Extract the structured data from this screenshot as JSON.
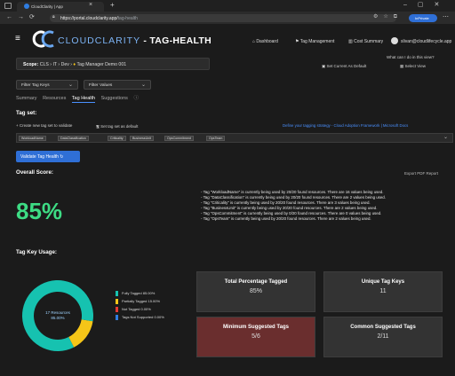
{
  "browser": {
    "tab_title": "CloudClarity | App",
    "url_host": "https://portal.cloudclarity.app/",
    "url_path": "tag-health",
    "user_badge": "InPrivate"
  },
  "header": {
    "logo_brand": "CLOUDCLARITY",
    "logo_suffix": " - TAG-HEALTH",
    "nav": [
      "Dashboard",
      "Tag Management",
      "Cost Summary"
    ],
    "user_email": "slivan@cloudlifecycle.app",
    "help_text": "What can I do in this view?",
    "set_default": "Set Current As Default",
    "select_view": "Select View"
  },
  "scope": {
    "label": "Scope:",
    "path": "CLS › IT › Dev › ",
    "current": "Tag Manager Demo 001"
  },
  "filters": {
    "tag_keys": "Filter Tag Keys",
    "values": "Filter Values"
  },
  "tabs": {
    "items": [
      "Summary",
      "Resources",
      "Tag Health",
      "Suggestions"
    ],
    "active_index": 2
  },
  "tagset": {
    "title": "Tag set:",
    "create": "Create new tag set to validate",
    "set_default": "Set tag set as default",
    "docs_link": "Define your tagging strategy - Cloud Adoption Framework | Microsoft Docs",
    "tags": [
      "WorkloadName",
      "DataClassification",
      "Criticality",
      "BusinessUnit",
      "OpsCommitment",
      "OpsTeam"
    ]
  },
  "validate_button": "Validate Tag Health",
  "overall": {
    "title": "Overall Score:",
    "export": "Export PDF Report",
    "score": "85%",
    "messages": [
      "- Tag \"WorkloadName\" is currently being used by 20/20 found resources. There are 16 values being used.",
      "- Tag \"DataClassification\" is currently being used by 20/20 found resources. There are 2 values being used.",
      "- Tag \"Criticality\" is currently being used by 20/20 found resources. There are 3 values being used.",
      "- Tag \"BusinessUnit\" is currently being used by 20/20 found resources. There are 2 values being used.",
      "- Tag \"OpsCommitment\" is currently being used by 0/20 found resources. There are 0 values being used.",
      "- Tag \"OpsTeam\" is currently being used by 20/20 found resources. There are 2 values being used."
    ]
  },
  "usage": {
    "title": "Tag Key Usage:",
    "center_line1": "17 Resources",
    "center_line2": "85.00%",
    "legend": [
      {
        "label": "Fully Tagged 85.00%",
        "color": "#16c2b0",
        "value": 85
      },
      {
        "label": "Partially Tagged 15.00%",
        "color": "#f5c518",
        "value": 15
      },
      {
        "label": "Not Tagged 0.00%",
        "color": "#e53935",
        "value": 0
      },
      {
        "label": "Tags Not Supported 0.00%",
        "color": "#2f7de1",
        "value": 0
      }
    ]
  },
  "cards": [
    {
      "title": "Total Percentage Tagged",
      "value": "85%"
    },
    {
      "title": "Unique Tag Keys",
      "value": "11"
    },
    {
      "title": "Minimum Suggested Tags",
      "value": "5/6"
    },
    {
      "title": "Common Suggested Tags",
      "value": "2/11"
    }
  ]
}
